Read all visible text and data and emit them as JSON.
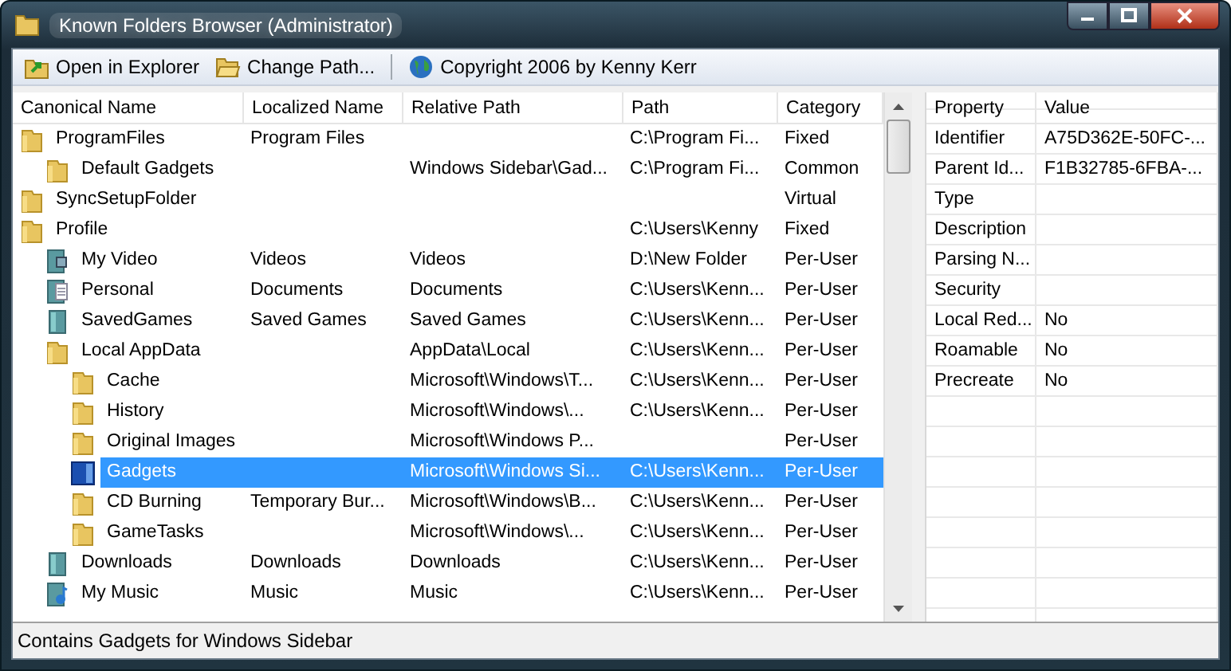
{
  "window": {
    "title": "Known Folders Browser (Administrator)"
  },
  "toolbar": [
    {
      "label": "Open in Explorer",
      "kind": "open"
    },
    {
      "label": "Change Path...",
      "kind": "folder"
    },
    {
      "label": "Copyright 2006 by Kenny Kerr",
      "kind": "globe"
    }
  ],
  "folders": {
    "columns": [
      "Canonical Name",
      "Localized Name",
      "Relative Path",
      "Path",
      "Category"
    ],
    "rows": [
      {
        "kind": "folder",
        "name": "ProgramFiles",
        "localized": "Program Files",
        "path": "C:\\Program Fi...",
        "category": "Fixed",
        "selected": false,
        "children": [
          {
            "kind": "folder",
            "name": "Default Gadgets",
            "relative": "Windows Sidebar\\Gad...",
            "path": "C:\\Program Fi...",
            "category": "Common",
            "selected": false
          }
        ]
      },
      {
        "kind": "folder",
        "name": "SyncSetupFolder",
        "category": "Virtual",
        "selected": false
      },
      {
        "kind": "folder",
        "name": "Profile",
        "path": "C:\\Users\\Kenny",
        "category": "Fixed",
        "selected": false,
        "children": [
          {
            "kind": "video",
            "name": "My Video",
            "localized": "Videos",
            "relative": "Videos",
            "path": "D:\\New Folder",
            "category": "Per-User",
            "selected": false
          },
          {
            "kind": "document",
            "name": "Personal",
            "localized": "Documents",
            "relative": "Documents",
            "path": "C:\\Users\\Kenn...",
            "category": "Per-User",
            "selected": false
          },
          {
            "kind": "library",
            "name": "SavedGames",
            "localized": "Saved Games",
            "relative": "Saved Games",
            "path": "C:\\Users\\Kenn...",
            "category": "Per-User",
            "selected": false
          },
          {
            "kind": "folder",
            "name": "Local AppData",
            "relative": "AppData\\Local",
            "path": "C:\\Users\\Kenn...",
            "category": "Per-User",
            "selected": false,
            "children": [
              {
                "kind": "folder",
                "name": "Cache",
                "relative": "Microsoft\\Windows\\T...",
                "path": "C:\\Users\\Kenn...",
                "category": "Per-User",
                "selected": false
              },
              {
                "kind": "folder",
                "name": "History",
                "relative": "Microsoft\\Windows\\...",
                "path": "C:\\Users\\Kenn...",
                "category": "Per-User",
                "selected": false
              },
              {
                "kind": "folder",
                "name": "Original Images",
                "relative": "Microsoft\\Windows P...",
                "category": "Per-User",
                "selected": false
              },
              {
                "kind": "gadget",
                "name": "Gadgets",
                "relative": "Microsoft\\Windows Si...",
                "path": "C:\\Users\\Kenn...",
                "category": "Per-User",
                "selected": true
              },
              {
                "kind": "folder",
                "name": "CD Burning",
                "localized": "Temporary Bur...",
                "relative": "Microsoft\\Windows\\B...",
                "path": "C:\\Users\\Kenn...",
                "category": "Per-User",
                "selected": false
              },
              {
                "kind": "folder",
                "name": "GameTasks",
                "relative": "Microsoft\\Windows\\...",
                "path": "C:\\Users\\Kenn...",
                "category": "Per-User",
                "selected": false
              }
            ]
          },
          {
            "kind": "library",
            "name": "Downloads",
            "localized": "Downloads",
            "relative": "Downloads",
            "path": "C:\\Users\\Kenn...",
            "category": "Per-User",
            "selected": false
          },
          {
            "kind": "music",
            "name": "My Music",
            "localized": "Music",
            "relative": "Music",
            "path": "C:\\Users\\Kenn...",
            "category": "Per-User",
            "selected": false
          }
        ]
      }
    ]
  },
  "properties": {
    "columns": [
      "Property",
      "Value"
    ],
    "rows": [
      {
        "property": "Identifier",
        "value": "A75D362E-50FC-..."
      },
      {
        "property": "Parent Id...",
        "value": "F1B32785-6FBA-..."
      },
      {
        "property": "Type"
      },
      {
        "property": "Description"
      },
      {
        "property": "Parsing N..."
      },
      {
        "property": "Security"
      },
      {
        "property": "Local Red...",
        "value": "No"
      },
      {
        "property": "Roamable",
        "value": "No"
      },
      {
        "property": "Precreate",
        "value": "No"
      }
    ]
  },
  "status_bar": "Contains Gadgets for Windows Sidebar"
}
